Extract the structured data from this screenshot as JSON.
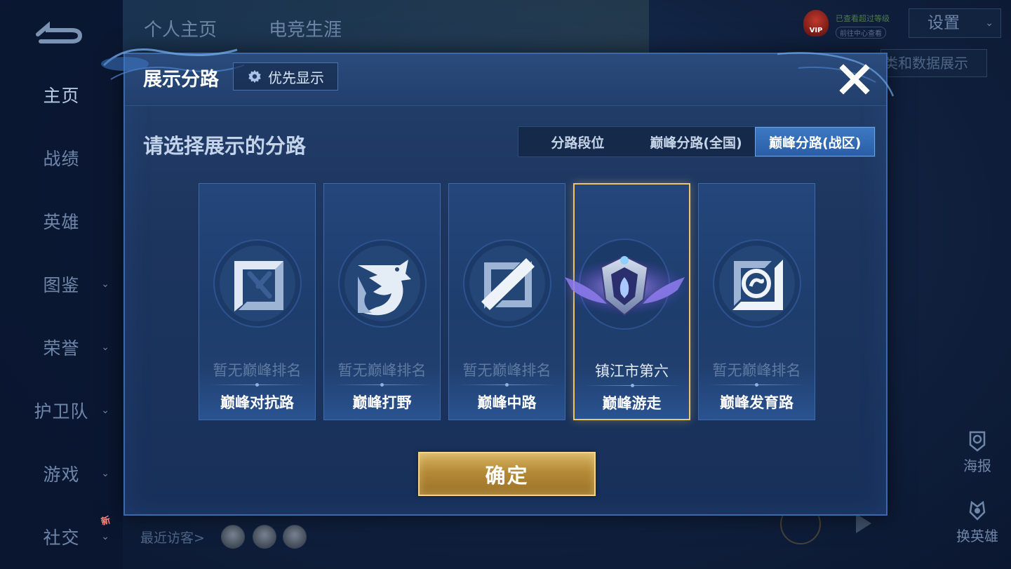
{
  "background": {
    "nav": {
      "items": [
        {
          "label": "主页",
          "active": true,
          "has_chevron": false
        },
        {
          "label": "战绩",
          "active": false,
          "has_chevron": false
        },
        {
          "label": "英雄",
          "active": false,
          "has_chevron": false
        },
        {
          "label": "图鉴",
          "active": false,
          "has_chevron": true
        },
        {
          "label": "荣誉",
          "active": false,
          "has_chevron": true
        },
        {
          "label": "护卫队",
          "active": false,
          "has_chevron": true
        },
        {
          "label": "游戏",
          "active": false,
          "has_chevron": true
        },
        {
          "label": "社交",
          "active": false,
          "has_chevron": true
        }
      ],
      "new_badge": "新"
    },
    "top_tabs": [
      "个人主页",
      "电竞生涯"
    ],
    "vip": {
      "badge": "VIP",
      "line1": "已查看超过等级",
      "line2": "前往中心查看"
    },
    "settings": {
      "label": "设置"
    },
    "right_label": "类和数据展示",
    "side_tools": [
      {
        "label": "海报",
        "icon": "poster-icon"
      },
      {
        "label": "换英雄",
        "icon": "swap-hero-icon"
      }
    ],
    "recent_visitors_label": "最近访客>",
    "visitor_count_shown": 3
  },
  "dialog": {
    "title": "展示分路",
    "priority_button": {
      "label": "优先显示",
      "icon": "gear-icon"
    },
    "close_icon": "close-icon",
    "subtitle": "请选择展示的分路",
    "tabs": [
      {
        "label": "分路段位",
        "active": false
      },
      {
        "label": "巅峰分路(全国)",
        "active": false
      },
      {
        "label": "巅峰分路(战区)",
        "active": true
      }
    ],
    "cards": [
      {
        "rank": "暂无巅峰排名",
        "lane": "巅峰对抗路",
        "icon": "clash-lane-icon",
        "selected": false
      },
      {
        "rank": "暂无巅峰排名",
        "lane": "巅峰打野",
        "icon": "jungle-dragon-icon",
        "selected": false
      },
      {
        "rank": "暂无巅峰排名",
        "lane": "巅峰中路",
        "icon": "mid-lane-icon",
        "selected": false
      },
      {
        "rank": "镇江市第六",
        "lane": "巅峰游走",
        "icon": "roam-winged-emblem-icon",
        "selected": true
      },
      {
        "rank": "暂无巅峰排名",
        "lane": "巅峰发育路",
        "icon": "farm-lane-icon",
        "selected": false
      }
    ],
    "confirm_button": "确定"
  },
  "colors": {
    "accent_gold": "#e8c86a",
    "tab_active": "#3d78c4",
    "dialog_bg": "#1c355e"
  }
}
